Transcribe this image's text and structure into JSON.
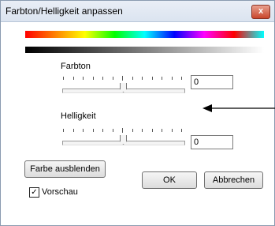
{
  "window": {
    "title": "Farbton/Helligkeit anpassen",
    "close_glyph": "x"
  },
  "farbton": {
    "label": "Farbton",
    "value": "0"
  },
  "helligkeit": {
    "label": "Helligkeit",
    "value": "0"
  },
  "buttons": {
    "hide_color": "Farbe ausblenden",
    "ok": "OK",
    "cancel": "Abbrechen"
  },
  "preview": {
    "label": "Vorschau",
    "checked": true,
    "check_glyph": "✓"
  },
  "icons": {
    "close": "close-icon",
    "arrow": "arrow-left-icon"
  },
  "colors": {
    "title_bg": "#dbe4f0",
    "close_btn": "#c9462c",
    "dialog_bg": "#ffffff"
  }
}
